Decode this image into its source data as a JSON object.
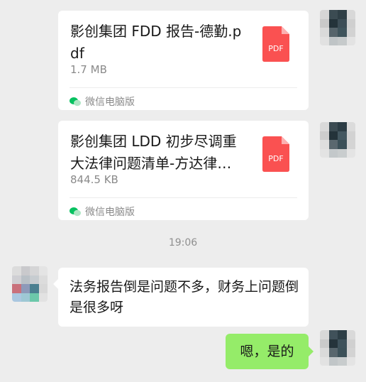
{
  "messages": {
    "file1": {
      "name": "影创集团 FDD 报告-德勤.pdf",
      "size": "1.7 MB",
      "source": "微信电脑版",
      "icon": "pdf-icon",
      "icon_label": "PDF"
    },
    "file2": {
      "name": "影创集团 LDD 初步尽调重大法律问题清单-方达律…",
      "size": "844.5 KB",
      "source": "微信电脑版",
      "icon": "pdf-icon",
      "icon_label": "PDF"
    },
    "timestamp": "19:06",
    "incoming_text": "法务报告倒是问题不多，财务上问题倒是很多呀",
    "outgoing_text": "嗯，是的"
  },
  "colors": {
    "background": "#ededed",
    "bubble_out": "#95ec69",
    "bubble_in": "#ffffff",
    "pdf_red": "#fa5151",
    "wechat_green": "#07c160"
  }
}
